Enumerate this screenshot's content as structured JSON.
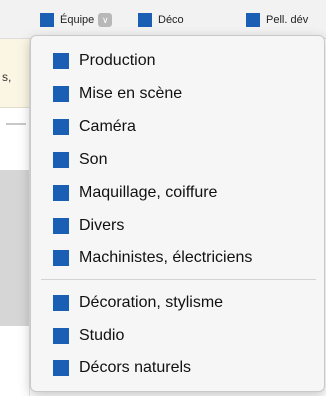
{
  "toolbar": {
    "items": [
      {
        "label": "Équipe",
        "has_dropdown": true
      },
      {
        "label": "Déco"
      },
      {
        "label": "Pell. dév"
      }
    ],
    "dropdown_arrow_icon": "chevron-down-icon"
  },
  "background": {
    "partial_text": "s,"
  },
  "menu": {
    "group1": [
      {
        "label": "Production"
      },
      {
        "label": "Mise en scène"
      },
      {
        "label": "Caméra"
      },
      {
        "label": "Son"
      },
      {
        "label": "Maquillage, coiffure"
      },
      {
        "label": "Divers"
      },
      {
        "label": "Machinistes, électriciens"
      }
    ],
    "group2": [
      {
        "label": "Décoration, stylisme"
      },
      {
        "label": "Studio"
      },
      {
        "label": "Décors naturels"
      }
    ]
  },
  "colors": {
    "swatch": "#1a5fb4",
    "menu_bg": "#f6f6f6",
    "toolbar_bg": "#f2f2f2"
  }
}
